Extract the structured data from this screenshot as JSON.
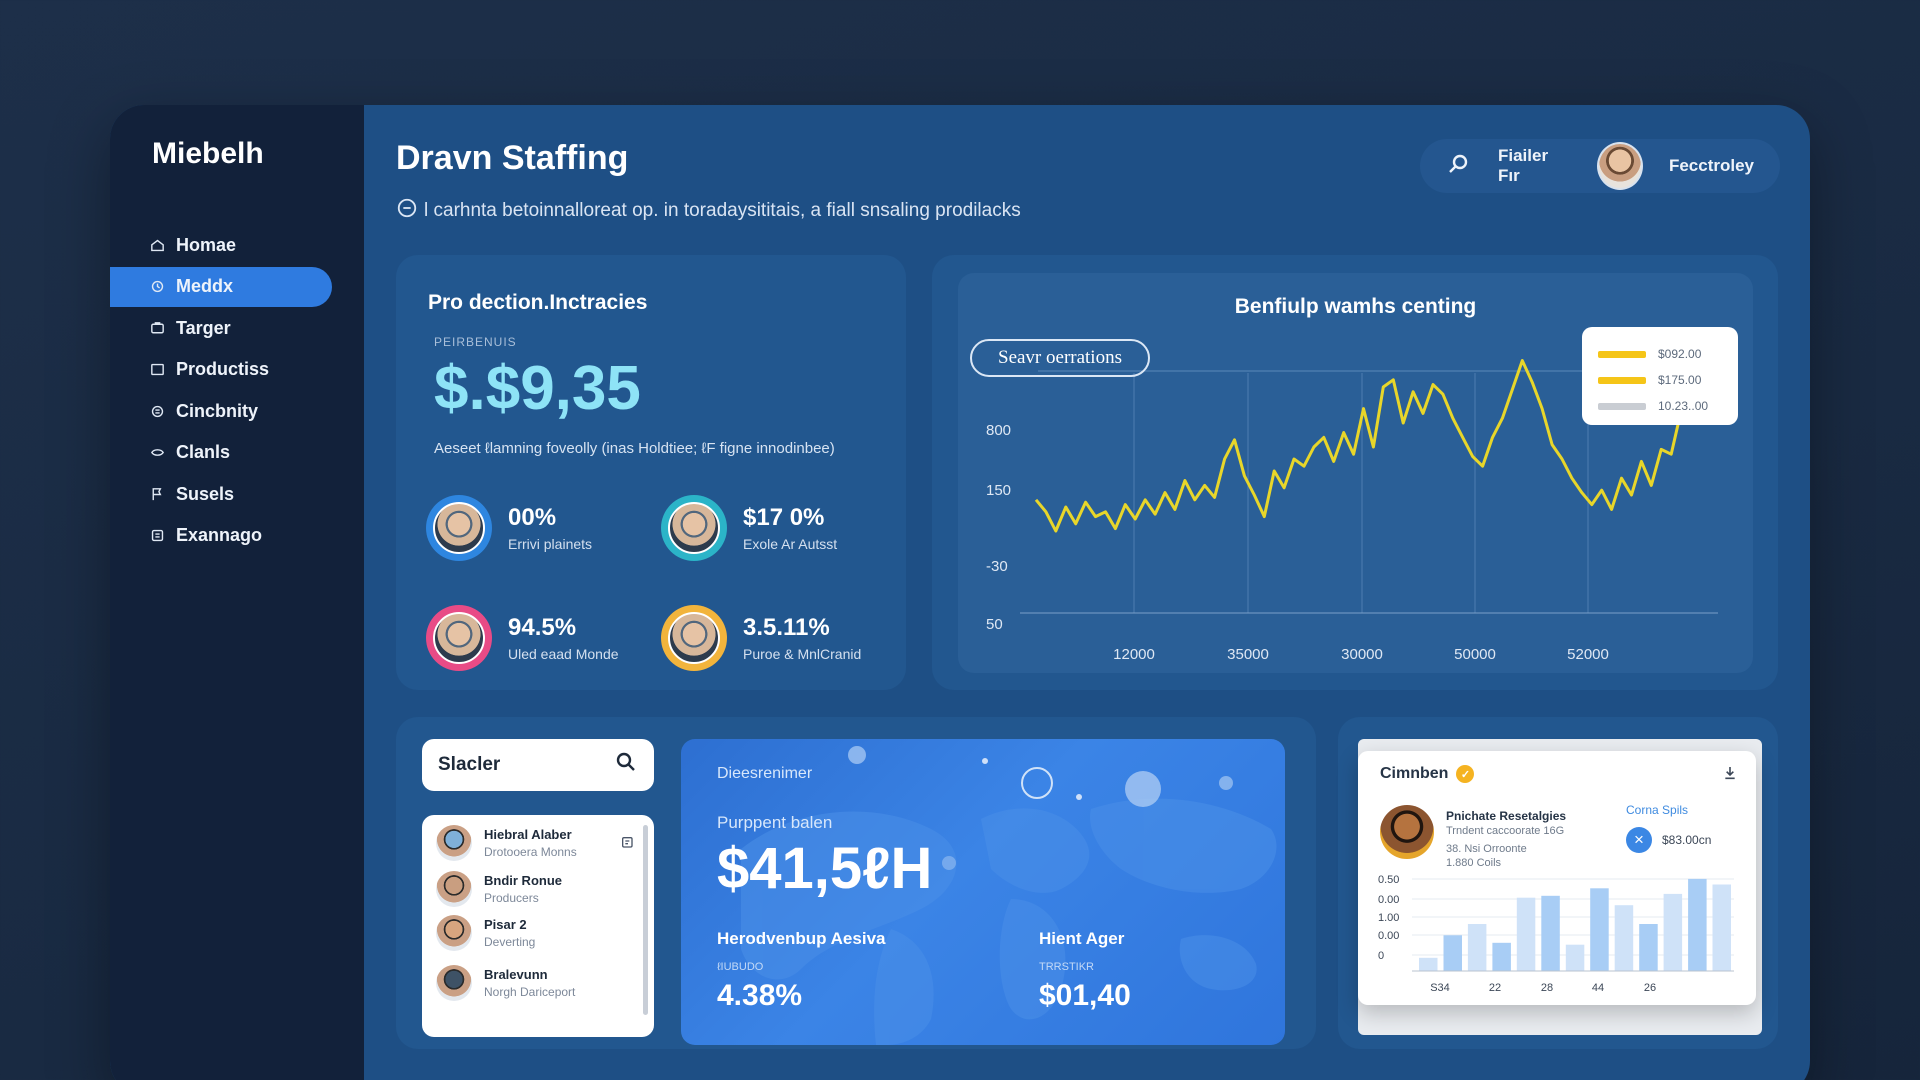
{
  "app": {
    "brand": "Miebelh",
    "page_title": "Dravn Staffing",
    "page_subtitle": "l carhnta betoinnalloreat op. in toradaysititais, a fiall snsaling prodilacks"
  },
  "sidebar": {
    "items": [
      {
        "label": "Homae",
        "icon": "home-icon",
        "active": false
      },
      {
        "label": "Meddx",
        "icon": "media-icon",
        "active": true
      },
      {
        "label": "Targer",
        "icon": "target-icon",
        "active": false
      },
      {
        "label": "Productiss",
        "icon": "product-icon",
        "active": false
      },
      {
        "label": "Cincbnity",
        "icon": "community-icon",
        "active": false
      },
      {
        "label": "Clanls",
        "icon": "clients-icon",
        "active": false
      },
      {
        "label": "Susels",
        "icon": "flag-icon",
        "active": false
      },
      {
        "label": "Exannago",
        "icon": "exchange-icon",
        "active": false
      }
    ]
  },
  "header": {
    "filter_label": "Fiailer Fır",
    "user_name": "Fecctroley"
  },
  "production": {
    "title": "Pro dection.Inctracies",
    "kicker": "PEIRBENUIS",
    "value": "$.$9,35",
    "description": "Aeseet ℓlamning foveolly (inas Holdtiee; ℓF figne innodinbee)",
    "stats": [
      {
        "value": "00%",
        "label": "Errivi plainets",
        "ring": "#2e86e0"
      },
      {
        "value": "$17 0%",
        "label": "Exole Ar Autsst",
        "ring": "#2bb4c8"
      },
      {
        "value": "94.5%",
        "label": "Uled eaad Monde",
        "ring": "#e84b86"
      },
      {
        "value": "3.5.11%",
        "label": "Puroe & MnlCranid",
        "ring": "#f2b43c"
      }
    ]
  },
  "chart_panel": {
    "chip_label": "Seavr oerrations",
    "legend": [
      {
        "label": "$092.00",
        "color": "#f5c518"
      },
      {
        "label": "$175.00",
        "color": "#f5c518"
      },
      {
        "label": "10.23..00",
        "color": "#c9cdd3"
      }
    ]
  },
  "chart_data": [
    {
      "type": "line",
      "title": "Benfiulp wamhs centing",
      "xlabel": "",
      "ylabel": "",
      "x_ticks": [
        "12000",
        "35000",
        "30000",
        "50000",
        "52000"
      ],
      "y_ticks": [
        "800",
        "150",
        "-30",
        "50"
      ],
      "grid": true,
      "legend_position": "top-right",
      "series": [
        {
          "color": "#e8d62a",
          "values": [
            0.38,
            0.33,
            0.25,
            0.35,
            0.28,
            0.37,
            0.31,
            0.33,
            0.26,
            0.36,
            0.3,
            0.38,
            0.32,
            0.41,
            0.34,
            0.46,
            0.38,
            0.44,
            0.39,
            0.55,
            0.63,
            0.48,
            0.4,
            0.31,
            0.5,
            0.43,
            0.55,
            0.52,
            0.6,
            0.64,
            0.54,
            0.66,
            0.57,
            0.76,
            0.6,
            0.85,
            0.88,
            0.7,
            0.83,
            0.74,
            0.86,
            0.82,
            0.72,
            0.64,
            0.56,
            0.52,
            0.64,
            0.72,
            0.84,
            0.96,
            0.87,
            0.76,
            0.61,
            0.55,
            0.47,
            0.41,
            0.36,
            0.42,
            0.34,
            0.47,
            0.4,
            0.54,
            0.44,
            0.59,
            0.57,
            0.75,
            0.98
          ]
        }
      ]
    },
    {
      "type": "bar",
      "title": "",
      "x_ticks": [
        "S34",
        "22",
        "28",
        "44",
        "26"
      ],
      "y_ticks": [
        "0.50",
        "0.00",
        "1.00",
        "0.00",
        "0"
      ],
      "values": [
        0.14,
        0.38,
        0.5,
        0.3,
        0.78,
        0.8,
        0.28,
        0.88,
        0.7,
        0.5,
        0.82,
        0.98,
        0.92
      ],
      "colors": [
        "#cfe2f8",
        "#a8cdf5"
      ]
    }
  ],
  "directory": {
    "search_label": "Slacler",
    "people": [
      {
        "name": "Hiebral Alaber",
        "role": "Drotooera Monns",
        "face": "#7fb0d9"
      },
      {
        "name": "Bndir Ronue",
        "role": "Producers",
        "face": "#c99e80"
      },
      {
        "name": "Pisar 2",
        "role": "Deverting",
        "face": "#d7a57f"
      },
      {
        "name": "Bralevunn",
        "role": "Norgh Dariceport",
        "face": "#3e5266"
      }
    ]
  },
  "overview": {
    "label": "Dieesrenimer",
    "kicker": "Purppent balen",
    "value": "$41,5ℓH",
    "left_title": "Herodvenbup Aesiva",
    "left_mini": "ℓIUBUDO",
    "left_value": "4.38%",
    "right_title": "Hient Ager",
    "right_mini": "TRRSTIKR",
    "right_value": "$01,40"
  },
  "comment": {
    "title": "Cimnben",
    "name": "Pnichate Resetalgies",
    "line1": "Trndent caccoorate 16G",
    "line2": "38. Nsi Orroonte",
    "line3": "1.880 Coils",
    "link": "Corna Spils",
    "amount": "$83.00cn"
  }
}
